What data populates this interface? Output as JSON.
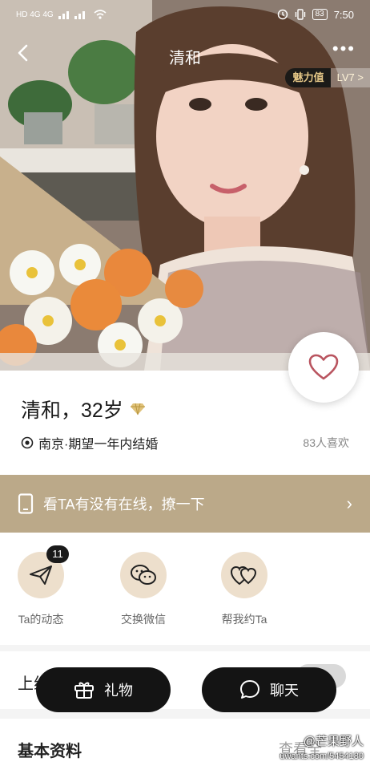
{
  "status_bar": {
    "left": "HD 4G 4G",
    "battery": "83",
    "time": "7:50"
  },
  "nav": {
    "title": "清和",
    "more": "•••"
  },
  "charm": {
    "label": "魅力值",
    "level": "LV7 >"
  },
  "profile": {
    "name_age": "清和，32岁",
    "location": "南京·期望一年内结婚",
    "likes": "83人喜欢"
  },
  "online": {
    "text": "看TA有没有在线，撩一下",
    "chevron": "›"
  },
  "actions": [
    {
      "label": "Ta的动态",
      "badge": "11",
      "icon": "paper-plane-icon"
    },
    {
      "label": "交换微信",
      "icon": "wechat-icon"
    },
    {
      "label": "帮我约Ta",
      "icon": "hearts-icon"
    }
  ],
  "section_upper": {
    "label": "上线"
  },
  "section_basic": {
    "label": "基本资料",
    "more": "查看全"
  },
  "buttons": {
    "gift": "礼物",
    "chat": "聊天"
  },
  "watermark": {
    "line1": "@芒果野人",
    "line2": "uwants.com/5454180"
  },
  "colors": {
    "accent": "#bba989",
    "dark": "#141414",
    "icon_bg": "#eddfcc"
  }
}
